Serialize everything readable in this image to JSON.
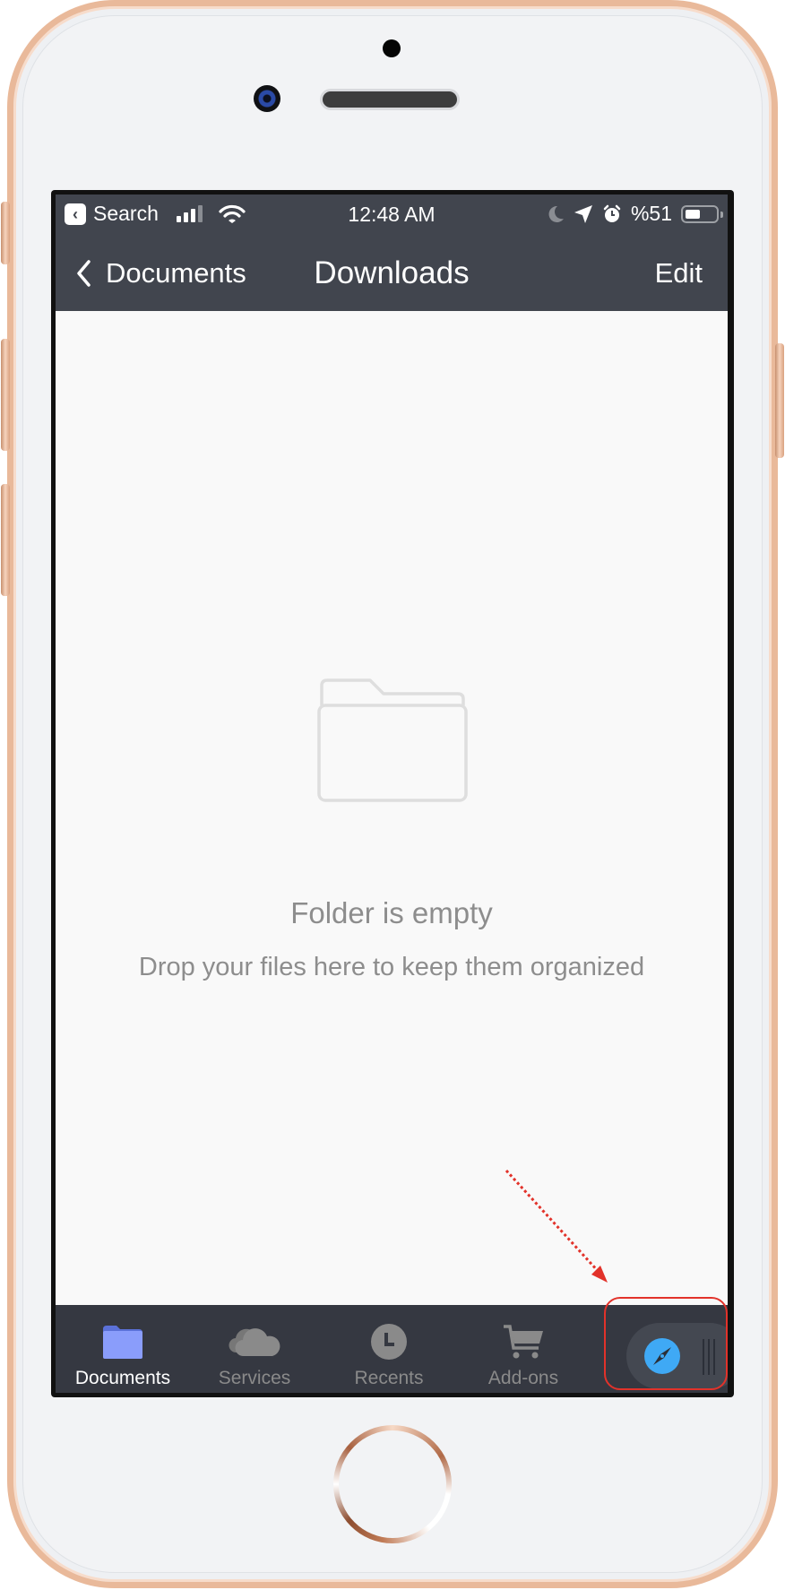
{
  "status_bar": {
    "back_app_label": "Search",
    "time": "12:48 AM",
    "battery_text": "%51",
    "battery_level": 0.51,
    "icons": [
      "back-to-app-icon",
      "cellular-signal-icon",
      "wifi-icon",
      "do-not-disturb-moon-icon",
      "location-arrow-icon",
      "alarm-clock-icon",
      "battery-icon"
    ]
  },
  "nav": {
    "back_label": "Documents",
    "title": "Downloads",
    "edit_label": "Edit"
  },
  "empty_state": {
    "icon": "folder-outline-icon",
    "title": "Folder is empty",
    "subtitle": "Drop your files here to keep them organized"
  },
  "tab_bar": {
    "tabs": [
      {
        "label": "Documents",
        "icon": "folder-icon",
        "active": true
      },
      {
        "label": "Services",
        "icon": "cloud-icon",
        "active": false
      },
      {
        "label": "Recents",
        "icon": "clock-icon",
        "active": false
      },
      {
        "label": "Add-ons",
        "icon": "cart-icon",
        "active": false
      }
    ],
    "floating_browser": {
      "icon": "compass-icon",
      "handle_icon": "drag-handle-icon"
    }
  },
  "colors": {
    "bar_bg": "#41454e",
    "tab_bar_bg": "#353841",
    "active_tab_icon": "#8a9dfb",
    "inactive": "#8a8a8a",
    "compass_blue": "#3fa9f5",
    "annotation_red": "#e2322a",
    "phone_frame": "#e9b99a"
  }
}
